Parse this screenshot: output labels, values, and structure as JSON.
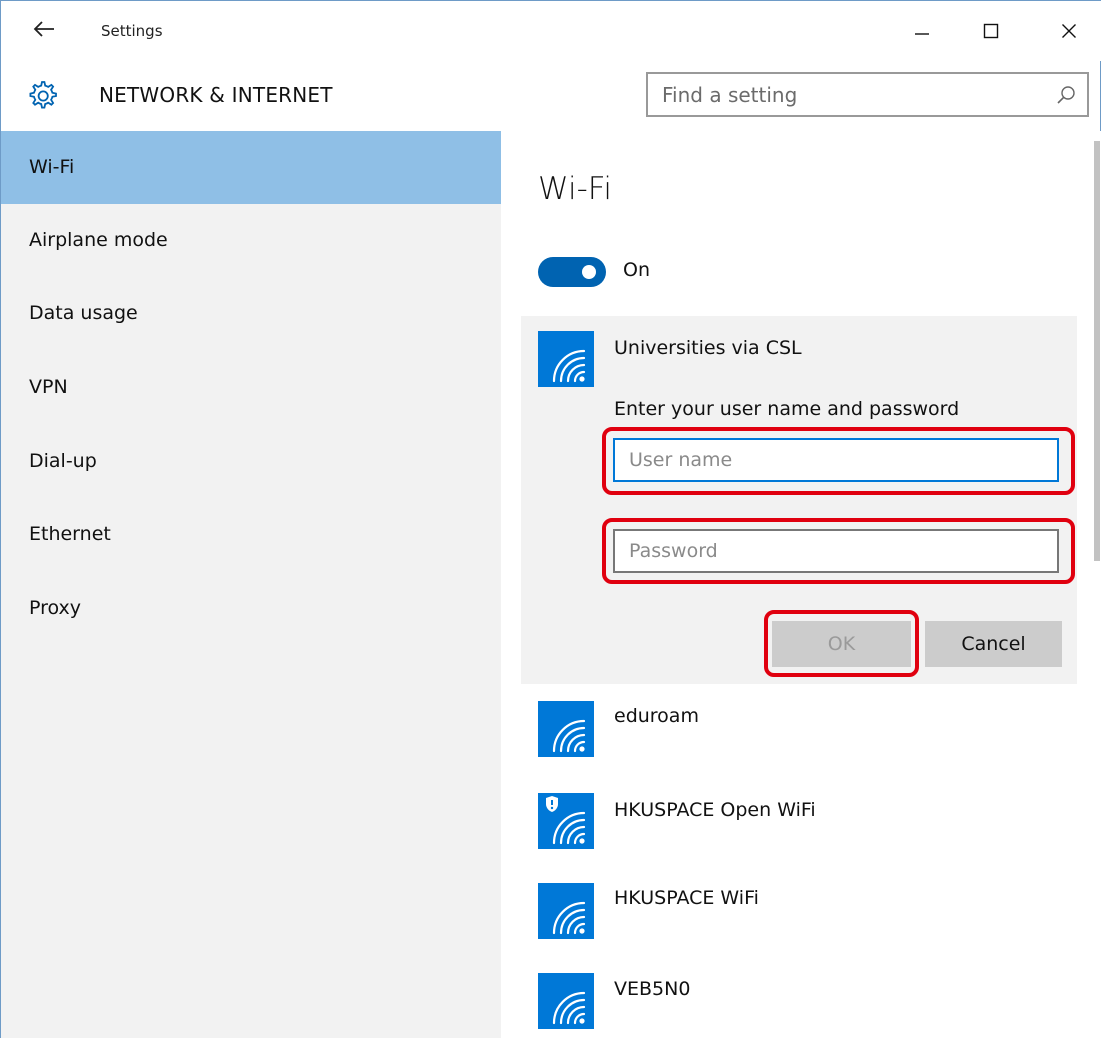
{
  "window": {
    "title": "Settings"
  },
  "header": {
    "section_title": "NETWORK & INTERNET",
    "search_placeholder": "Find a setting"
  },
  "sidebar": {
    "items": [
      {
        "label": "Wi-Fi",
        "active": true
      },
      {
        "label": "Airplane mode",
        "active": false
      },
      {
        "label": "Data usage",
        "active": false
      },
      {
        "label": "VPN",
        "active": false
      },
      {
        "label": "Dial-up",
        "active": false
      },
      {
        "label": "Ethernet",
        "active": false
      },
      {
        "label": "Proxy",
        "active": false
      }
    ]
  },
  "main": {
    "heading": "Wi-Fi",
    "toggle_label": "On",
    "toggle_on": true,
    "expanded_network": {
      "name": "Universities via CSL",
      "prompt": "Enter your user name and password",
      "username_placeholder": "User name",
      "password_placeholder": "Password",
      "ok_label": "OK",
      "cancel_label": "Cancel"
    },
    "networks": [
      {
        "name": "eduroam",
        "secured": true,
        "warning": false
      },
      {
        "name": "HKUSPACE Open WiFi",
        "secured": false,
        "warning": true
      },
      {
        "name": "HKUSPACE WiFi",
        "secured": true,
        "warning": false
      },
      {
        "name": "VEB5N0",
        "secured": true,
        "warning": false
      }
    ]
  },
  "colors": {
    "accent": "#0078d7",
    "toggle": "#0063b1",
    "nav_active": "#8fbfe6",
    "highlight": "#e0000f"
  }
}
